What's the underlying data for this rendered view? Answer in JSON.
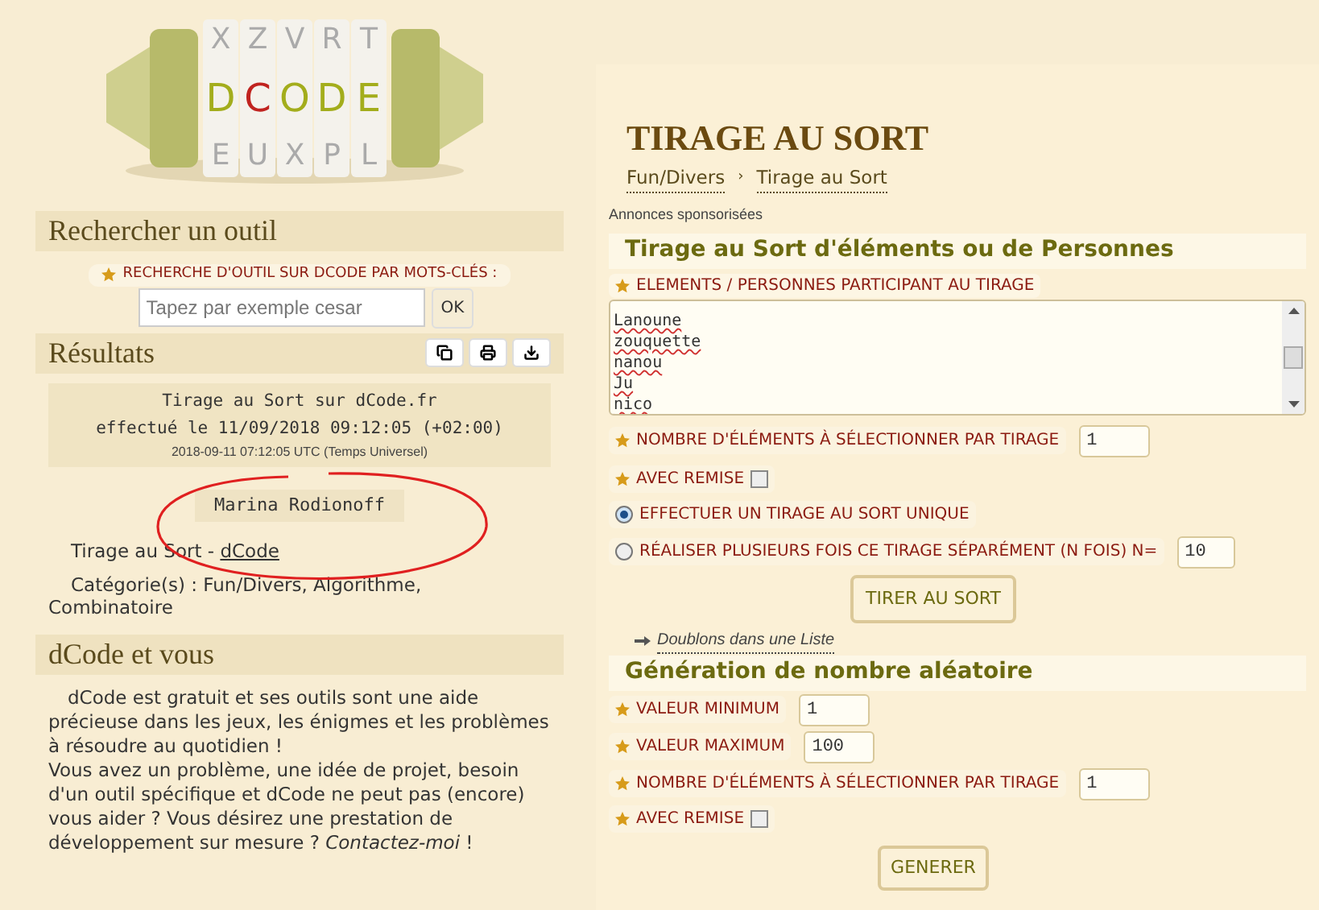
{
  "logo": {
    "top_row": [
      "X",
      "Z",
      "V",
      "R",
      "T"
    ],
    "word": [
      {
        "char": "D",
        "color": "#a3ad1c"
      },
      {
        "char": "C",
        "color": "#c0231f"
      },
      {
        "char": "O",
        "color": "#a3ad1c"
      },
      {
        "char": "D",
        "color": "#a3ad1c"
      },
      {
        "char": "E",
        "color": "#a3ad1c"
      }
    ],
    "bottom_row": [
      "E",
      "U",
      "X",
      "P",
      "L"
    ]
  },
  "search": {
    "title": "Rechercher un outil",
    "label": "RECHERCHE D'OUTIL SUR DCODE PAR MOTS-CLÉS :",
    "placeholder": "Tapez par exemple cesar",
    "button": "OK"
  },
  "results": {
    "title": "Résultats",
    "header_lines": [
      "Tirage au Sort sur dCode.fr",
      "effectué le 11/09/2018 09:12:05 (+02:00)"
    ],
    "utc": "2018-09-11 07:12:05 UTC (Temps Universel)",
    "result": "Marina Rodionoff",
    "source_text": "Tirage au Sort - ",
    "source_link": "dCode",
    "categories": "Catégorie(s) : Fun/Divers, Algorithme, Combinatoire"
  },
  "about": {
    "title": "dCode et vous",
    "intro": "dCode est gratuit et ses outils sont une aide précieuse dans les jeux, les énigmes et les problèmes à résoudre au quotidien !",
    "body": "Vous avez un problème, une idée de projet, besoin d'un outil spécifique et dCode ne peut pas (encore) vous aider ? Vous désirez une prestation de développement sur mesure ?",
    "link": "Contactez-moi",
    "end": " !"
  },
  "page": {
    "title": "TIRAGE AU SORT",
    "breadcrumb": [
      "Fun/Divers",
      "Tirage au Sort"
    ],
    "breadcrumb_separator": "›",
    "ads": "Annonces sponsorisées"
  },
  "draw": {
    "title": "Tirage au Sort d'éléments ou de Personnes",
    "list_label": "ELEMENTS / PERSONNES PARTICIPANT AU TIRAGE",
    "list_lines": [
      "Lanoune",
      "zouquette",
      "nanou",
      "Ju",
      "nico"
    ],
    "fields": [
      {
        "kind": "number",
        "label": "NOMBRE D'ÉLÉMENTS À SÉLECTIONNER PAR TIRAGE",
        "value": "1"
      },
      {
        "kind": "checkbox",
        "label": "AVEC REMISE",
        "checked": false
      },
      {
        "kind": "radio",
        "label": "EFFECTUER UN TIRAGE AU SORT UNIQUE",
        "selected": true
      },
      {
        "kind": "radio",
        "label": "RÉALISER PLUSIEURS FOIS CE TIRAGE SÉPARÉMENT (N FOIS) N=",
        "selected": false,
        "value": "10"
      }
    ],
    "button": "TIRER AU SORT",
    "see_also": "Doublons dans une Liste"
  },
  "random": {
    "title": "Génération de nombre aléatoire",
    "fields": [
      {
        "kind": "number",
        "label": "VALEUR MINIMUM",
        "value": "1"
      },
      {
        "kind": "number",
        "label": "VALEUR MAXIMUM",
        "value": "100"
      },
      {
        "kind": "number",
        "label": "NOMBRE D'ÉLÉMENTS À SÉLECTIONNER PAR TIRAGE",
        "value": "1"
      },
      {
        "kind": "checkbox",
        "label": "AVEC REMISE",
        "checked": false
      }
    ],
    "button": "GENERER"
  }
}
